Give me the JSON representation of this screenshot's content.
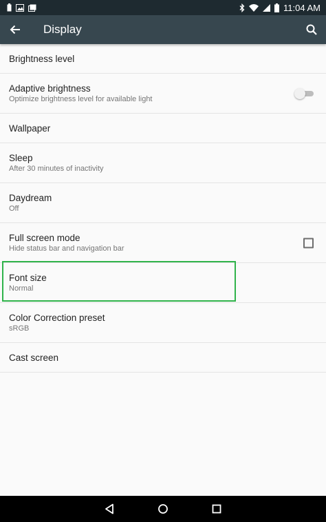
{
  "status_bar": {
    "time": "11:04 AM",
    "icons_left": [
      "battery-saver-icon",
      "image-icon",
      "gallery-icon"
    ],
    "icons_right": [
      "bluetooth-icon",
      "wifi-icon",
      "signal-icon",
      "battery-icon"
    ]
  },
  "toolbar": {
    "title": "Display",
    "back_icon": "arrow-back-icon",
    "search_icon": "search-icon",
    "color": "#37474f"
  },
  "settings": {
    "brightness": {
      "title": "Brightness level"
    },
    "adaptive": {
      "title": "Adaptive brightness",
      "summary": "Optimize brightness level for available light",
      "toggle_on": false
    },
    "wallpaper": {
      "title": "Wallpaper"
    },
    "sleep": {
      "title": "Sleep",
      "summary": "After 30 minutes of inactivity"
    },
    "daydream": {
      "title": "Daydream",
      "summary": "Off"
    },
    "fullscreen": {
      "title": "Full screen mode",
      "summary": "Hide status bar and navigation bar",
      "checked": false
    },
    "font_size": {
      "title": "Font size",
      "summary": "Normal"
    },
    "color_correction": {
      "title": "Color Correction preset",
      "summary": "sRGB"
    },
    "cast": {
      "title": "Cast screen"
    }
  },
  "highlight_color": "#2fb34a",
  "nav_bar": {
    "icons": [
      "back-triangle-icon",
      "home-circle-icon",
      "recents-square-icon"
    ]
  }
}
